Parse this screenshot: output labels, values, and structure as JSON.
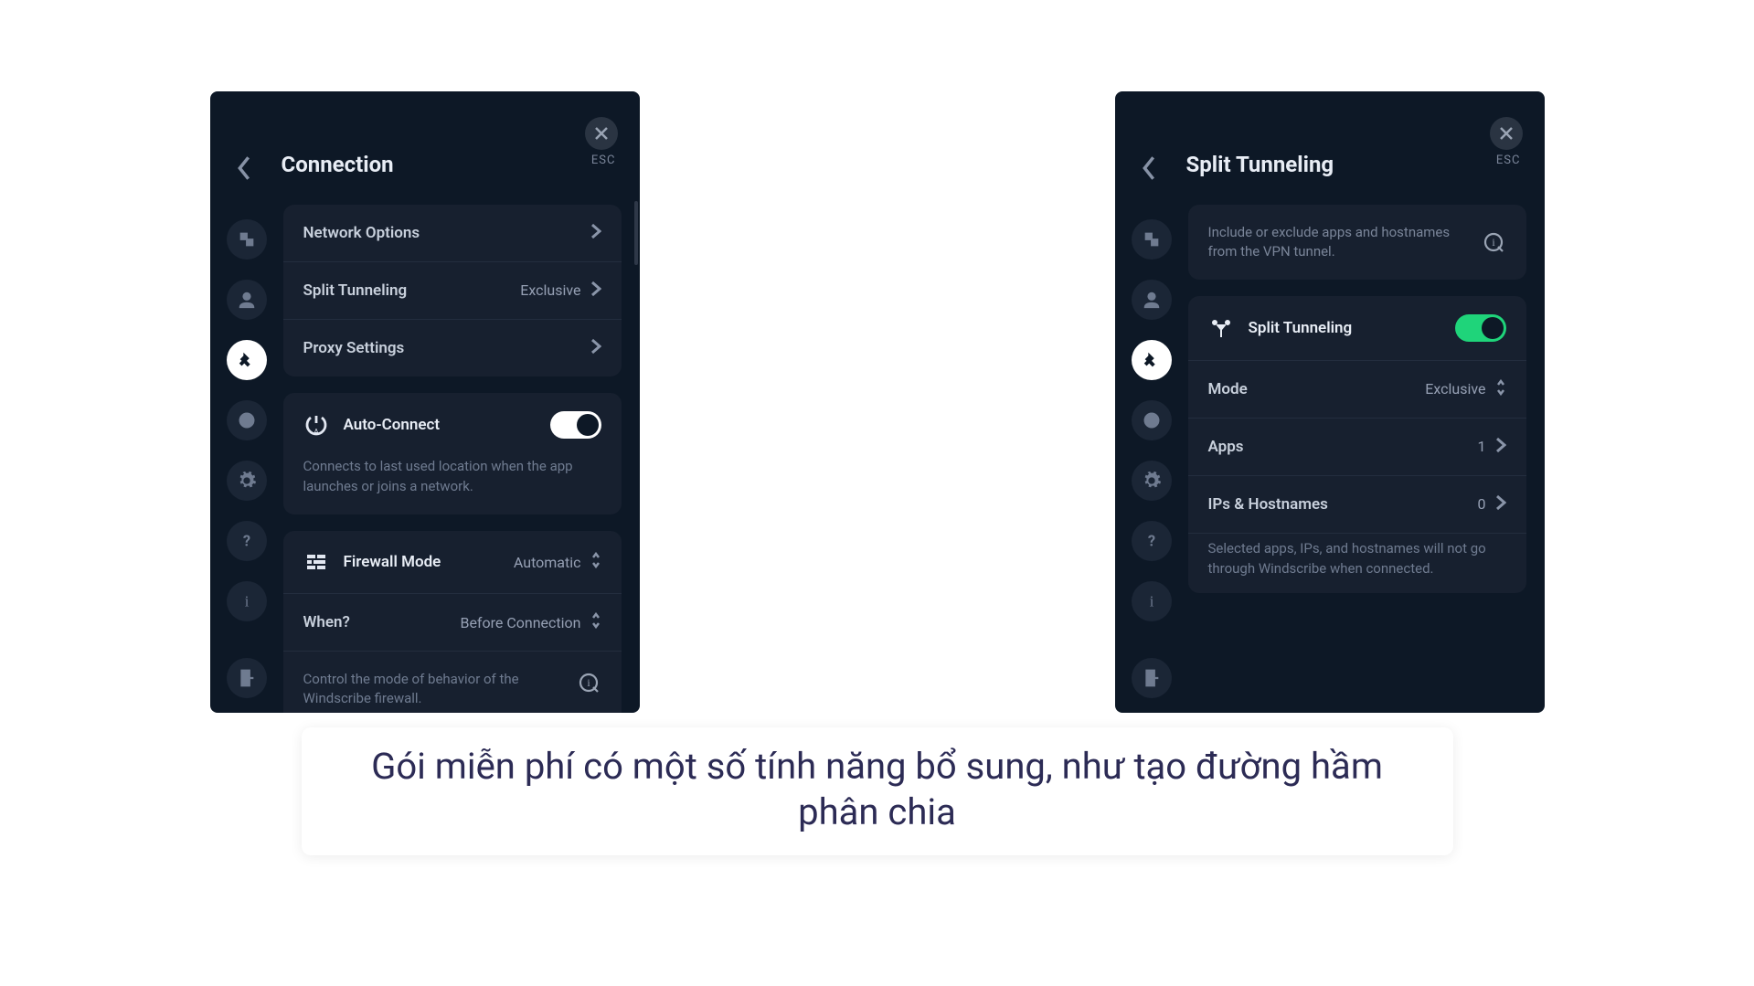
{
  "left": {
    "esc": "ESC",
    "title": "Connection",
    "rows": {
      "network_options": "Network Options",
      "split_tunneling": "Split Tunneling",
      "split_tunneling_value": "Exclusive",
      "proxy_settings": "Proxy Settings",
      "auto_connect": "Auto-Connect",
      "auto_connect_desc": "Connects to last used location when the app launches or joins a network.",
      "firewall_mode": "Firewall Mode",
      "firewall_mode_value": "Automatic",
      "when": "When?",
      "when_value": "Before Connection",
      "firewall_desc": "Control the mode of behavior of the Windscribe firewall."
    }
  },
  "right": {
    "esc": "ESC",
    "title": "Split Tunneling",
    "info": "Include or exclude apps and hostnames from the VPN tunnel.",
    "rows": {
      "split_tunneling": "Split Tunneling",
      "mode": "Mode",
      "mode_value": "Exclusive",
      "apps": "Apps",
      "apps_count": "1",
      "ips": "IPs & Hostnames",
      "ips_count": "0"
    },
    "footnote": "Selected apps, IPs, and hostnames will not go through Windscribe when connected."
  },
  "caption": "Gói miễn phí có một số tính năng bổ sung, như tạo đường hầm phân chia"
}
